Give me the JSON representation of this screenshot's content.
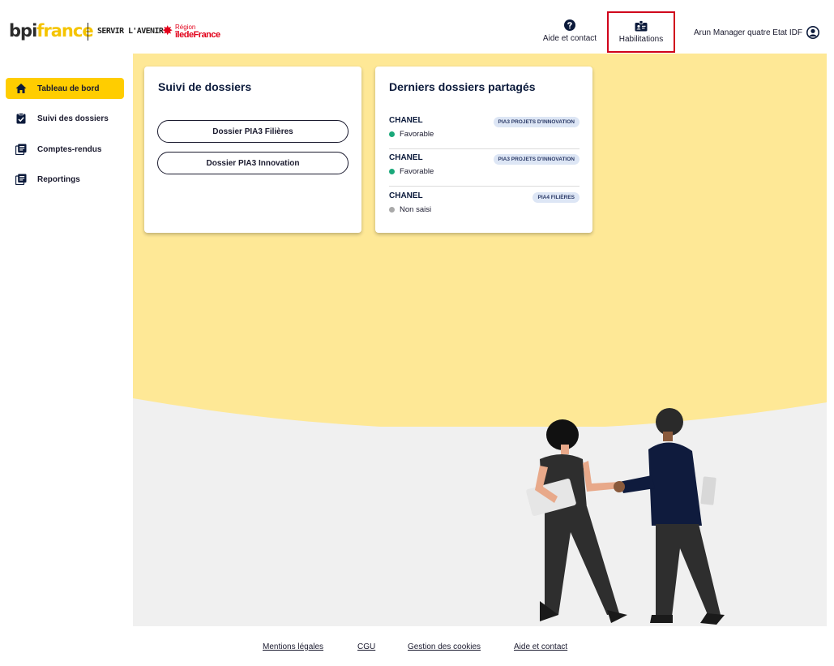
{
  "header": {
    "logo": {
      "bpi": "bpi",
      "france": "france"
    },
    "slogan": "SERVIR L'AVENIR",
    "region": {
      "line1": "Région",
      "line2": "îledeFrance"
    },
    "help_label": "Aide et contact",
    "habilitations_label": "Habilitations",
    "user_name": "Arun Manager quatre Etat IDF"
  },
  "sidebar": {
    "items": [
      {
        "label": "Tableau de bord",
        "icon": "home-icon",
        "active": true
      },
      {
        "label": "Suivi des dossiers",
        "icon": "clipboard-check-icon",
        "active": false
      },
      {
        "label": "Comptes-rendus",
        "icon": "document-stack-icon",
        "active": false
      },
      {
        "label": "Reportings",
        "icon": "document-stack-icon",
        "active": false
      }
    ]
  },
  "main": {
    "card_suivi": {
      "title": "Suivi de dossiers",
      "buttons": [
        "Dossier PIA3 Filières",
        "Dossier PIA3 Innovation"
      ]
    },
    "card_derniers": {
      "title": "Derniers dossiers partagés",
      "items": [
        {
          "name": "CHANEL",
          "status": "Favorable",
          "status_color": "#1aa87a",
          "tag": "PIA3 PROJETS D'INNOVATION"
        },
        {
          "name": "CHANEL",
          "status": "Favorable",
          "status_color": "#1aa87a",
          "tag": "PIA3 PROJETS D'INNOVATION"
        },
        {
          "name": "CHANEL",
          "status": "Non saisi",
          "status_color": "#a9a9a9",
          "tag": "PIA4 FILIÈRES"
        }
      ]
    }
  },
  "footer": {
    "links": [
      "Mentions légales",
      "CGU",
      "Gestion des cookies",
      "Aide et contact"
    ]
  },
  "colors": {
    "accent_yellow": "#ffcd00",
    "banner_yellow": "#fee896",
    "navy": "#0b1a3b",
    "highlight_red": "#d0021b"
  }
}
